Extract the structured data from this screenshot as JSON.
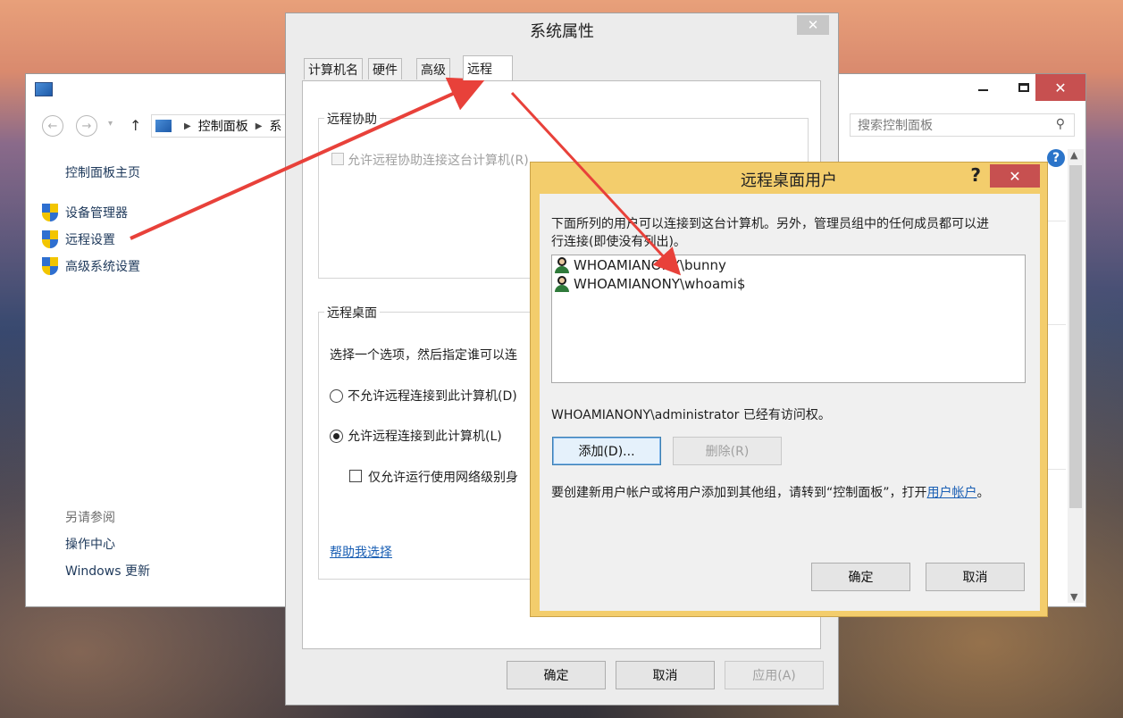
{
  "control_panel": {
    "breadcrumb": [
      "控制面板",
      "系"
    ],
    "search_placeholder": "搜索控制面板",
    "sidebar": {
      "home": "控制面板主页",
      "items": [
        {
          "label": "设备管理器"
        },
        {
          "label": "远程设置"
        },
        {
          "label": "高级系统设置"
        }
      ],
      "see_also": "另请参阅",
      "action_center": "操作中心",
      "windows_update": "Windows 更新"
    }
  },
  "system_properties": {
    "title": "系统属性",
    "tabs": [
      {
        "label": "计算机名"
      },
      {
        "label": "硬件"
      },
      {
        "label": "高级"
      },
      {
        "label": "远程"
      }
    ],
    "active_tab": "远程",
    "remote_assistance": {
      "group_label": "远程协助",
      "allow_label": "允许远程协助连接这台计算机(R)"
    },
    "remote_desktop": {
      "group_label": "远程桌面",
      "description": "选择一个选项，然后指定谁可以连",
      "option_deny": "不允许远程连接到此计算机(D)",
      "option_allow": "允许远程连接到此计算机(L)",
      "nla_label": "仅允许运行使用网络级别身",
      "help_link": "帮助我选择"
    },
    "buttons": {
      "ok": "确定",
      "cancel": "取消",
      "apply": "应用(A)"
    }
  },
  "remote_desktop_users": {
    "title": "远程桌面用户",
    "help_glyph": "?",
    "description_line1": "下面所列的用户可以连接到这台计算机。另外，管理员组中的任何成员都可以进",
    "description_line2": "行连接(即使没有列出)。",
    "users": [
      {
        "name": "WHOAMIANONY\\bunny"
      },
      {
        "name": "WHOAMIANONY\\whoami$"
      }
    ],
    "access_note": "WHOAMIANONY\\administrator 已经有访问权。",
    "add_button": "添加(D)...",
    "remove_button": "删除(R)",
    "footer_text": "要创建新用户帐户或将用户添加到其他组，请转到“控制面板”，打开",
    "footer_link": "用户帐户",
    "footer_end": "。",
    "buttons": {
      "ok": "确定",
      "cancel": "取消"
    }
  },
  "colors": {
    "arrow": "#e8413a",
    "link": "#1a5fb4",
    "dialog_frame_active": "#f3cd6c",
    "close_button": "#c75050"
  }
}
